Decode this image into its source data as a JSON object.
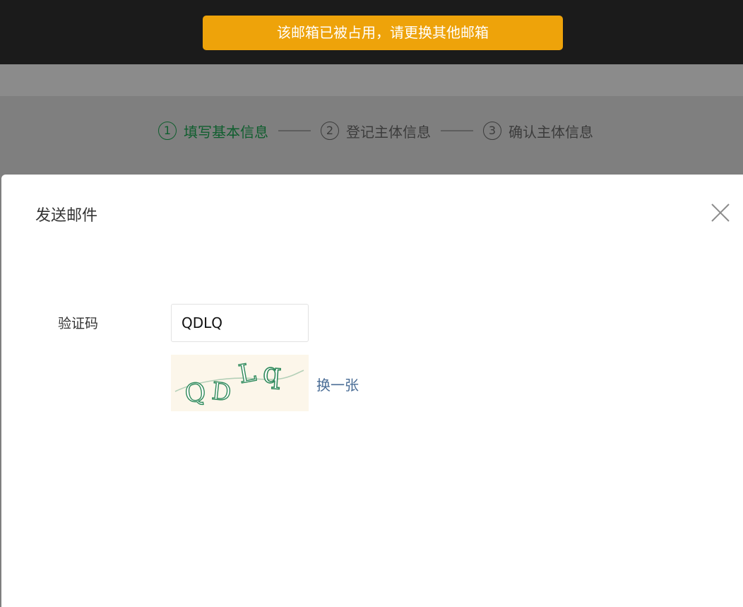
{
  "toast": {
    "message": "该邮箱已被占用，请更换其他邮箱"
  },
  "steps": [
    {
      "number": "1",
      "label": "填写基本信息",
      "active": true
    },
    {
      "number": "2",
      "label": "登记主体信息",
      "active": false
    },
    {
      "number": "3",
      "label": "确认主体信息",
      "active": false
    }
  ],
  "modal": {
    "title": "发送邮件",
    "captcha_label": "验证码",
    "captcha_value": "QDLQ",
    "captcha_image_text": "QDLq",
    "refresh_label": "换一张"
  },
  "colors": {
    "toast_bg": "#eea30a",
    "active_step": "#0f5e2e",
    "link": "#4a6d96",
    "captcha_glyph": "#2f8a5b"
  }
}
